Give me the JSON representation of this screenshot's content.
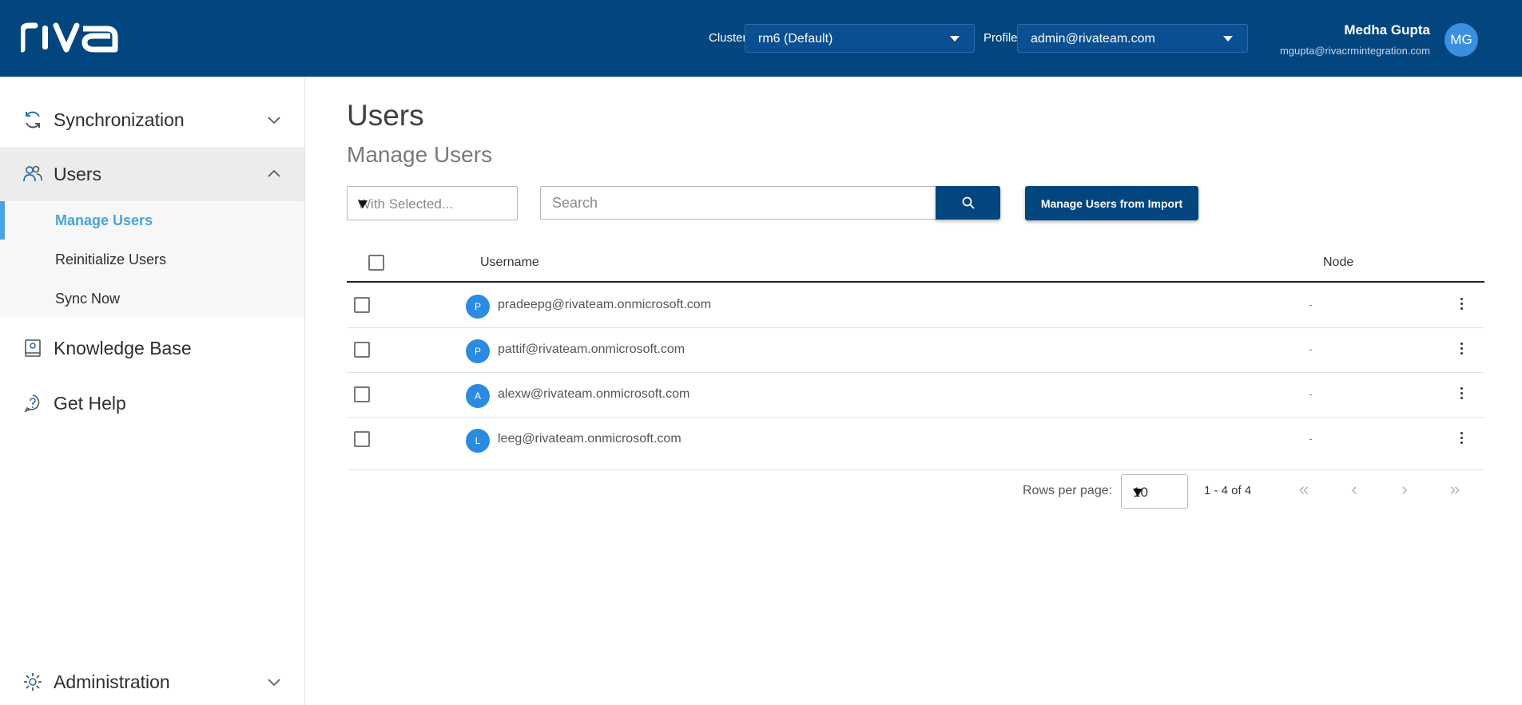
{
  "header": {
    "logo_alt": "riva",
    "cluster_label": "Cluster",
    "cluster_value": "rm6 (Default)",
    "profile_label": "Profile",
    "profile_value": "admin@rivateam.com",
    "user_name": "Medha Gupta",
    "user_email": "mgupta@rivacrmintegration.com",
    "user_initials": "MG"
  },
  "sidebar": {
    "items": [
      {
        "label": "Synchronization",
        "icon": "sync-icon",
        "expanded": false
      },
      {
        "label": "Users",
        "icon": "users-icon",
        "expanded": true
      },
      {
        "label": "Knowledge Base",
        "icon": "book-icon"
      },
      {
        "label": "Get Help",
        "icon": "help-icon"
      },
      {
        "label": "Administration",
        "icon": "gear-icon",
        "expanded": false
      }
    ],
    "users_submenu": [
      {
        "label": "Manage Users",
        "active": true
      },
      {
        "label": "Reinitialize Users"
      },
      {
        "label": "Sync Now"
      }
    ]
  },
  "main": {
    "title": "Users",
    "subtitle": "Manage Users",
    "with_selected_placeholder": "With Selected...",
    "search_placeholder": "Search",
    "import_button": "Manage Users from Import",
    "columns": {
      "username": "Username",
      "node": "Node"
    },
    "rows": [
      {
        "initial": "P",
        "username": "pradeepg@rivateam.onmicrosoft.com",
        "node": "-"
      },
      {
        "initial": "P",
        "username": "pattif@rivateam.onmicrosoft.com",
        "node": "-"
      },
      {
        "initial": "A",
        "username": "alexw@rivateam.onmicrosoft.com",
        "node": "-"
      },
      {
        "initial": "L",
        "username": "leeg@rivateam.onmicrosoft.com",
        "node": "-"
      }
    ],
    "pagination": {
      "rows_per_page_label": "Rows per page:",
      "rows_per_page_value": "10",
      "range": "1 - 4 of 4",
      "first": "«",
      "prev": "‹",
      "next": "›",
      "last": "»"
    }
  },
  "colors": {
    "header_bg": "#03457f",
    "accent": "#4aa3df",
    "avatar": "#2b8be0"
  }
}
